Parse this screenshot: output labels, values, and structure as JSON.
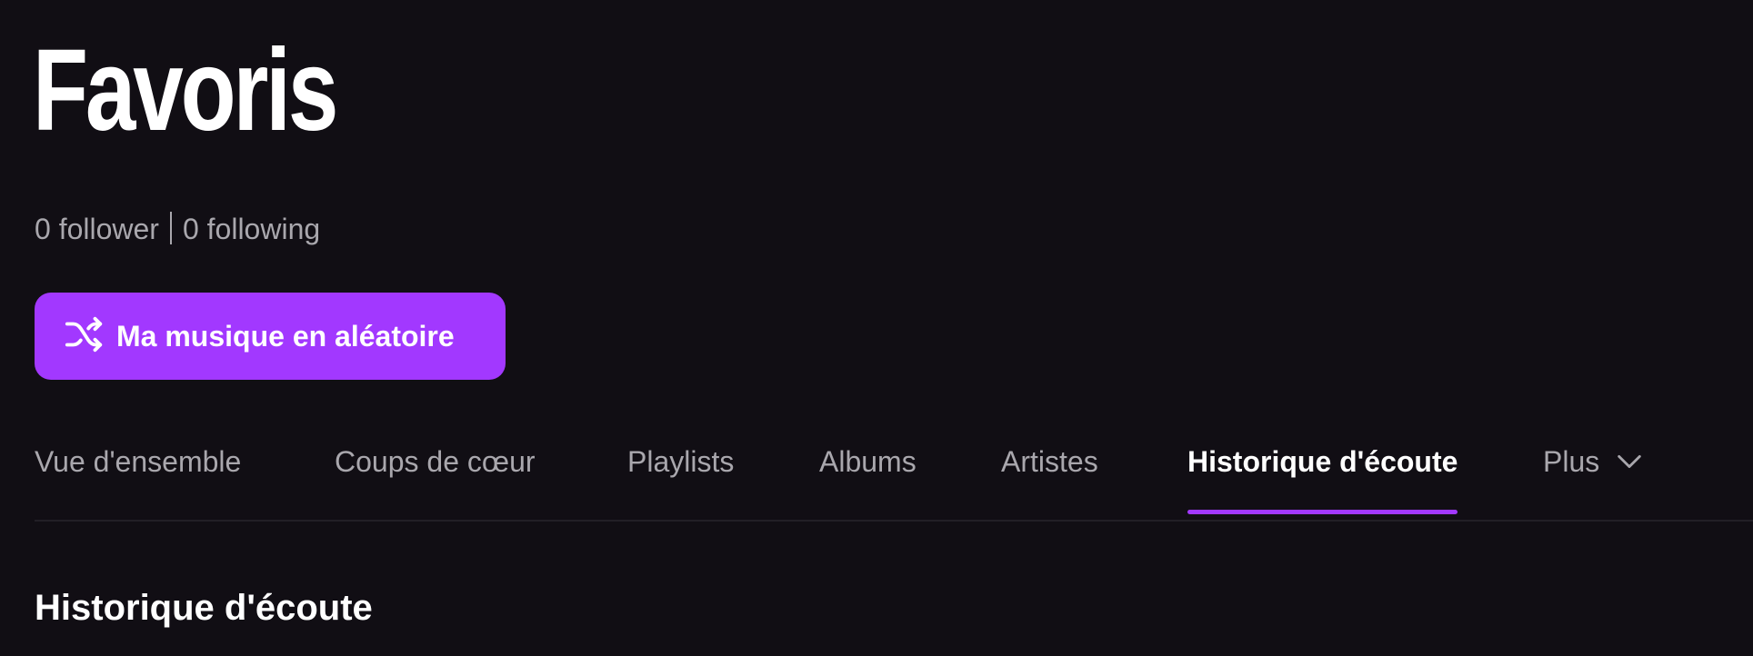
{
  "header": {
    "title": "Favoris",
    "followers": "0 follower",
    "following": "0 following"
  },
  "actions": {
    "shuffle_label": "Ma musique en aléatoire",
    "shuffle_icon": "shuffle-icon"
  },
  "tabs": [
    {
      "label": "Vue d'ensemble",
      "active": false
    },
    {
      "label": "Coups de cœur",
      "active": false
    },
    {
      "label": "Playlists",
      "active": false
    },
    {
      "label": "Albums",
      "active": false
    },
    {
      "label": "Artistes",
      "active": false
    },
    {
      "label": "Historique d'écoute",
      "active": true
    },
    {
      "label": "Plus",
      "active": false,
      "icon": "chevron-down-icon"
    }
  ],
  "section": {
    "title": "Historique d'écoute"
  },
  "colors": {
    "background": "#110e14",
    "accent": "#a238ff",
    "text_primary": "#ffffff",
    "text_secondary": "#a9a7ad"
  }
}
